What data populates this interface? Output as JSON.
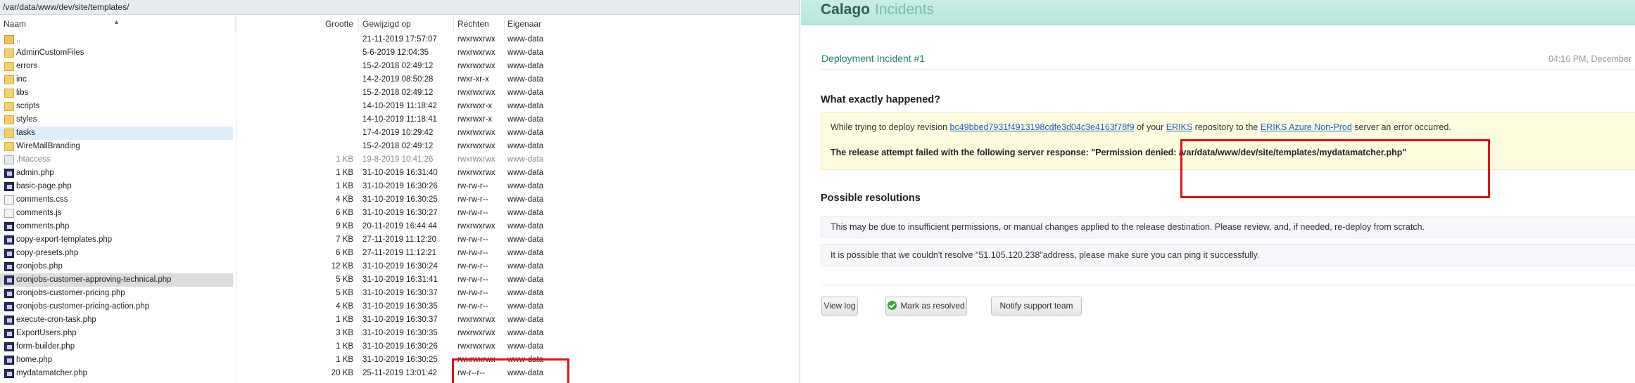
{
  "file_browser": {
    "path": "/var/data/www/dev/site/templates/",
    "columns": {
      "name": "Naam",
      "size": "Grootte",
      "modified": "Gewijzigd op",
      "rights": "Rechten",
      "owner": "Eigenaar"
    },
    "files": [
      {
        "icon": "folder-up-icon",
        "name": "..",
        "size": "",
        "modified": "21-11-2019 17:57:07",
        "rights": "rwxrwxrwx",
        "owner": "www-data"
      },
      {
        "icon": "folder-icon",
        "name": "AdminCustomFiles",
        "size": "",
        "modified": "5-6-2019 12:04:35",
        "rights": "rwxrwxrwx",
        "owner": "www-data"
      },
      {
        "icon": "folder-icon",
        "name": "errors",
        "size": "",
        "modified": "15-2-2018 02:49:12",
        "rights": "rwxrwxrwx",
        "owner": "www-data"
      },
      {
        "icon": "folder-icon",
        "name": "inc",
        "size": "",
        "modified": "14-2-2019 08:50:28",
        "rights": "rwxr-xr-x",
        "owner": "www-data"
      },
      {
        "icon": "folder-icon",
        "name": "libs",
        "size": "",
        "modified": "15-2-2018 02:49:12",
        "rights": "rwxrwxrwx",
        "owner": "www-data"
      },
      {
        "icon": "folder-icon",
        "name": "scripts",
        "size": "",
        "modified": "14-10-2019 11:18:42",
        "rights": "rwxrwxr-x",
        "owner": "www-data"
      },
      {
        "icon": "folder-icon",
        "name": "styles",
        "size": "",
        "modified": "14-10-2019 11:18:41",
        "rights": "rwxrwxr-x",
        "owner": "www-data"
      },
      {
        "icon": "folder-icon",
        "name": "tasks",
        "size": "",
        "modified": "17-4-2019 10:29:42",
        "rights": "rwxrwxrwx",
        "owner": "www-data"
      },
      {
        "icon": "folder-icon",
        "name": "WireMailBranding",
        "size": "",
        "modified": "15-2-2018 02:49:12",
        "rights": "rwxrwxrwx",
        "owner": "www-data"
      },
      {
        "icon": "php-file-icon",
        "name": ".htaccess",
        "size": "1 KB",
        "modified": "19-8-2019 10:41:26",
        "rights": "rwxrwxrwx",
        "owner": "www-data"
      },
      {
        "icon": "php-file-icon",
        "name": "admin.php",
        "size": "1 KB",
        "modified": "31-10-2019 16:31:40",
        "rights": "rwxrwxrwx",
        "owner": "www-data"
      },
      {
        "icon": "php-file-icon",
        "name": "basic-page.php",
        "size": "1 KB",
        "modified": "31-10-2019 16:30:26",
        "rights": "rw-rw-r--",
        "owner": "www-data"
      },
      {
        "icon": "css-file-icon",
        "name": "comments.css",
        "size": "4 KB",
        "modified": "31-10-2019 16:30:25",
        "rights": "rw-rw-r--",
        "owner": "www-data"
      },
      {
        "icon": "js-file-icon",
        "name": "comments.js",
        "size": "6 KB",
        "modified": "31-10-2019 16:30:27",
        "rights": "rw-rw-r--",
        "owner": "www-data"
      },
      {
        "icon": "php-file-icon",
        "name": "comments.php",
        "size": "9 KB",
        "modified": "20-11-2019 16:44:44",
        "rights": "rwxrwxrwx",
        "owner": "www-data"
      },
      {
        "icon": "php-file-icon",
        "name": "copy-export-templates.php",
        "size": "7 KB",
        "modified": "27-11-2019 11:12:20",
        "rights": "rw-rw-r--",
        "owner": "www-data"
      },
      {
        "icon": "php-file-icon",
        "name": "copy-presets.php",
        "size": "6 KB",
        "modified": "27-11-2019 11:12:21",
        "rights": "rw-rw-r--",
        "owner": "www-data"
      },
      {
        "icon": "php-file-icon",
        "name": "cronjobs.php",
        "size": "12 KB",
        "modified": "31-10-2019 16:30:24",
        "rights": "rw-rw-r--",
        "owner": "www-data"
      },
      {
        "icon": "php-file-icon",
        "name": "cronjobs-customer-approving-technical.php",
        "size": "5 KB",
        "modified": "31-10-2019 16:31:41",
        "rights": "rw-rw-r--",
        "owner": "www-data"
      },
      {
        "icon": "php-file-icon",
        "name": "cronjobs-customer-pricing.php",
        "size": "5 KB",
        "modified": "31-10-2019 16:30:37",
        "rights": "rw-rw-r--",
        "owner": "www-data"
      },
      {
        "icon": "php-file-icon",
        "name": "cronjobs-customer-pricing-action.php",
        "size": "4 KB",
        "modified": "31-10-2019 16:30:35",
        "rights": "rw-rw-r--",
        "owner": "www-data"
      },
      {
        "icon": "php-file-icon",
        "name": "execute-cron-task.php",
        "size": "1 KB",
        "modified": "31-10-2019 16:30:37",
        "rights": "rwxrwxrwx",
        "owner": "www-data"
      },
      {
        "icon": "php-file-icon",
        "name": "ExportUsers.php",
        "size": "3 KB",
        "modified": "31-10-2019 16:30:35",
        "rights": "rwxrwxrwx",
        "owner": "www-data"
      },
      {
        "icon": "php-file-icon",
        "name": "form-builder.php",
        "size": "1 KB",
        "modified": "31-10-2019 16:30:26",
        "rights": "rwxrwxrwx",
        "owner": "www-data"
      },
      {
        "icon": "php-file-icon",
        "name": "home.php",
        "size": "1 KB",
        "modified": "31-10-2019 16:30:25",
        "rights": "rwxrwxrwx",
        "owner": "www-data"
      },
      {
        "icon": "php-file-icon",
        "name": "mydatamatcher.php",
        "size": "20 KB",
        "modified": "25-11-2019 13:01:42",
        "rights": "rw-r--r--",
        "owner": "www-data"
      }
    ]
  },
  "incident": {
    "brand": "Calago",
    "section": "Incidents",
    "title": "Deployment Incident #1",
    "time": "04:16 PM, December",
    "what_heading": "What exactly happened?",
    "line1_pre": "While trying to deploy revision ",
    "revision": "bc49bbed7931f4913198cdfe3d04c3e4163f78f9",
    "line1_mid": " of your ",
    "repository": "ERIKS",
    "line1_mid2": " repository to the ",
    "server": "ERIKS Azure Non-Prod",
    "line1_post": " server an error occurred.",
    "server_response": "The release attempt failed with the following server response: \"Permission denied: /var/data/www/dev/site/templates/mydatamatcher.php\"",
    "resolutions_heading": "Possible resolutions",
    "resolution1": "This may be due to insufficient permissions, or manual changes applied to the release destination. Please review, and, if needed, re-deploy from scratch.",
    "resolution2": "It is possible that we couldn't resolve \"51.105.120.238\"address, please make sure you can ping it successfully.",
    "buttons": {
      "view_log": "View log",
      "mark_resolved": "Mark as resolved",
      "notify": "Notify support team"
    }
  },
  "colors": {
    "accent_red": "#e2121d",
    "link": "#1f5fbf",
    "header_teal": "#b4e7da"
  }
}
